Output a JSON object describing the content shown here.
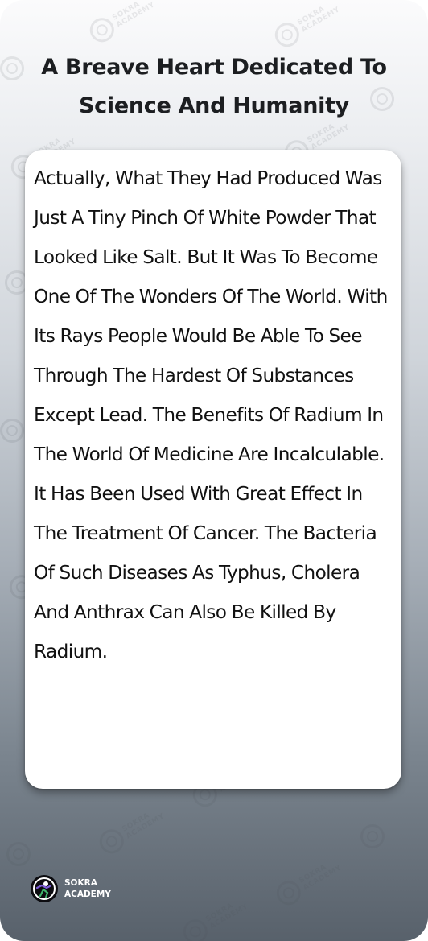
{
  "card": {
    "title": "A Breave Heart Dedicated To Science And Humanity",
    "body": "Actually, What They Had Produced Was Just A Tiny Pinch Of White Powder That Looked Like Salt. But It Was To Become One Of The Wonders Of The World. With Its Rays People Would Be Able To See Through The Hardest Of Substances Except Lead. The Benefits Of Radium In The World Of Medicine Are Incalculable. It Has Been Used With Great Effect In The Treatment Of Cancer. The Bacteria Of Such Diseases As Typhus, Cholera And Anthrax Can Also Be Killed By Radium."
  },
  "brand": {
    "line1": "SOKRA",
    "line2": "ACADEMY",
    "logo_icon": "sokra-academy-logo-icon",
    "watermark_text": "SOKRA ACADEMY"
  },
  "colors": {
    "title": "#1c1e21",
    "body_text": "#111111",
    "box_background": "#ffffff",
    "gradient_top": "#fbfbfc",
    "gradient_bottom": "#58616b",
    "logo_accent_green": "#3fb36b",
    "logo_accent_purple": "#7b5cd6"
  }
}
